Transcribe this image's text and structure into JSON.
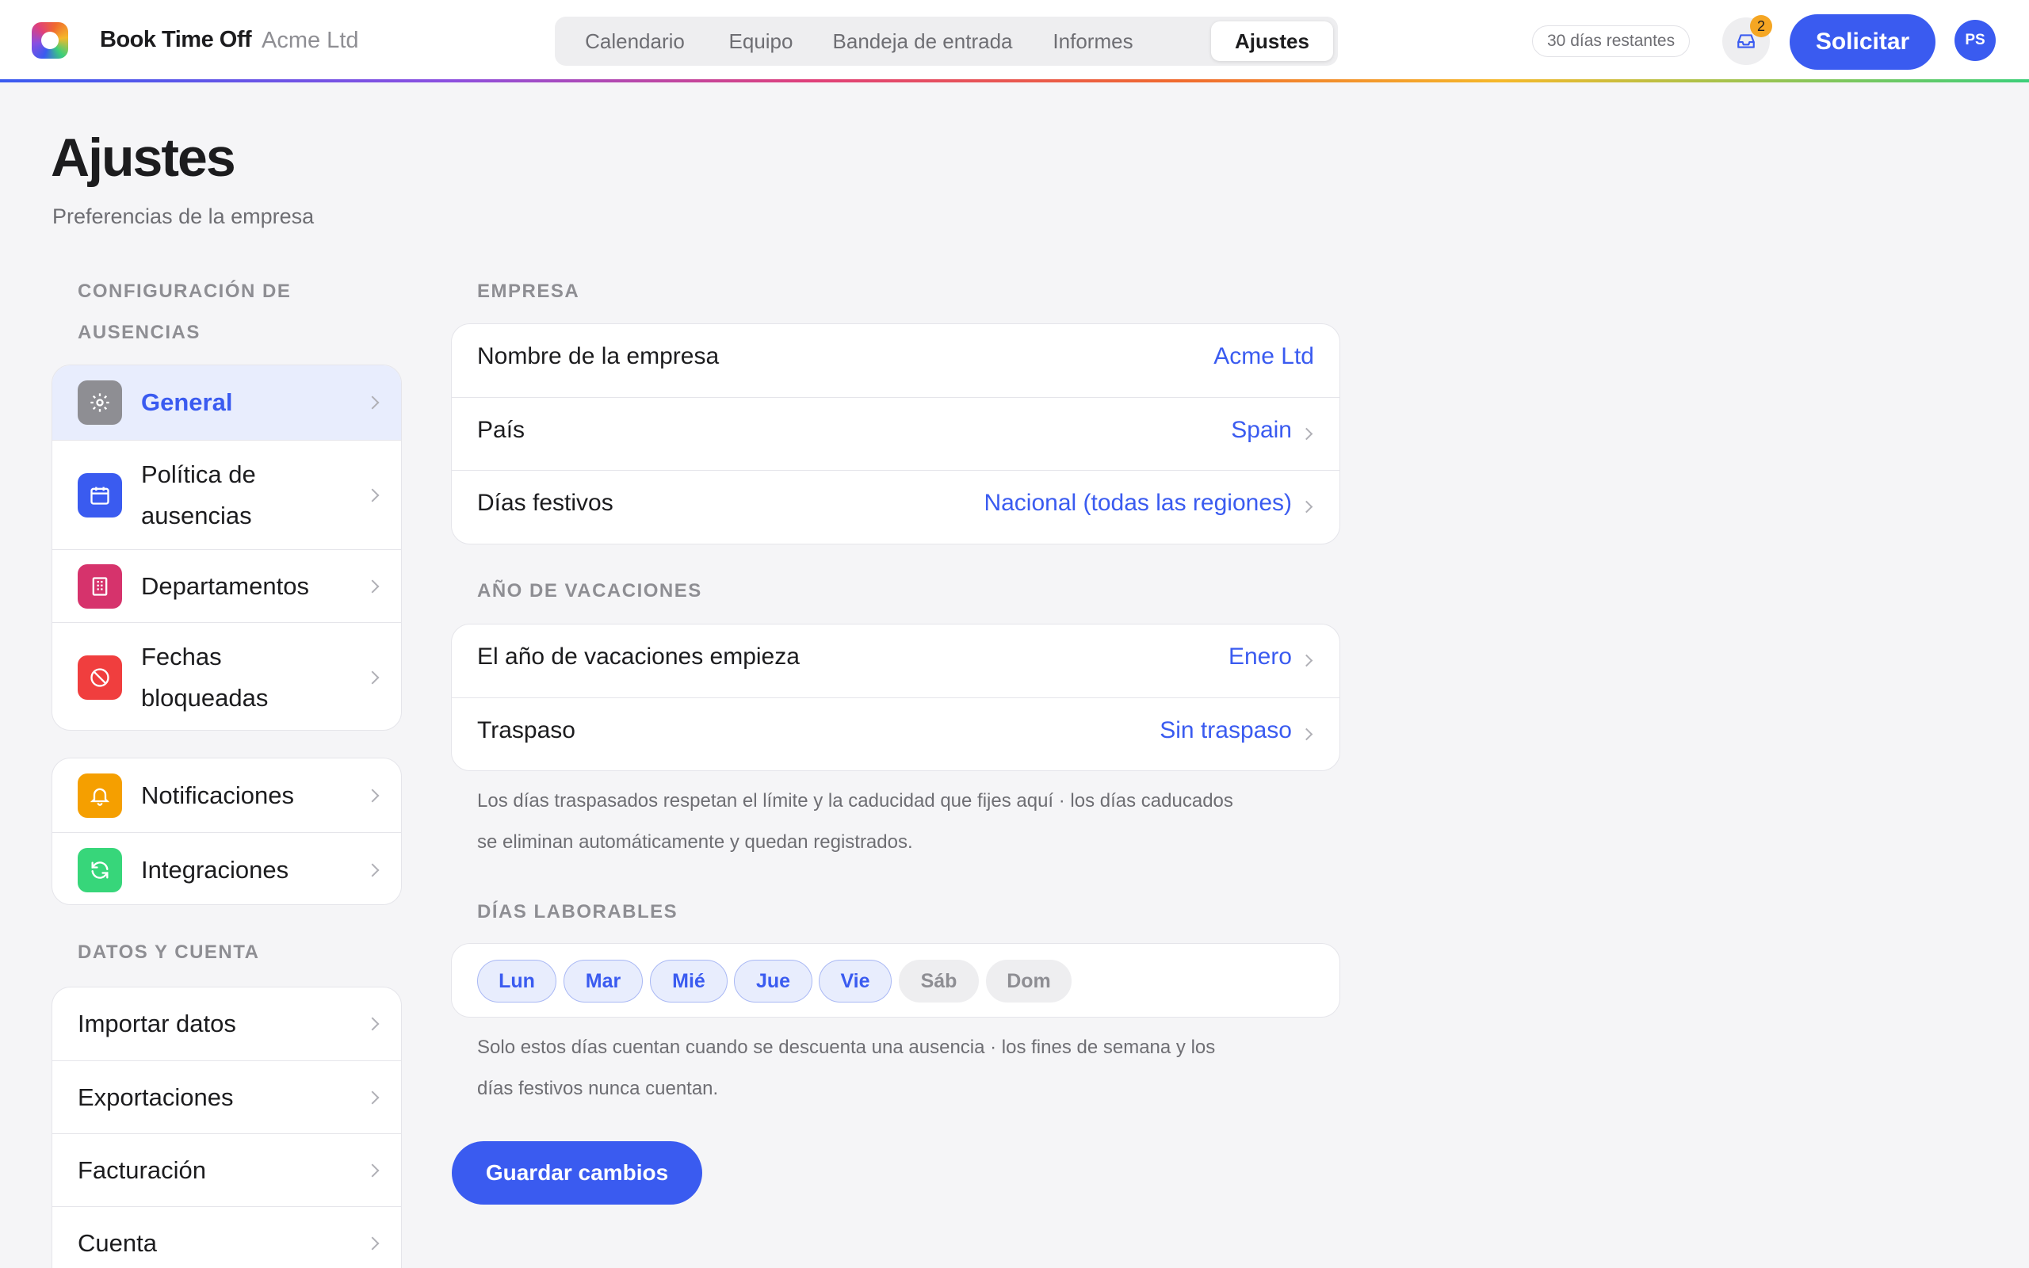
{
  "app": {
    "name": "Book Time Off",
    "company": "Acme Ltd"
  },
  "nav": {
    "tabs": [
      {
        "label": "Calendario"
      },
      {
        "label": "Equipo"
      },
      {
        "label": "Bandeja de entrada"
      },
      {
        "label": "Informes"
      },
      {
        "label": "Ajustes",
        "active": true
      }
    ]
  },
  "header": {
    "days_left": "30 días restantes",
    "inbox_count": "2",
    "request_label": "Solicitar",
    "avatar_initials": "PS"
  },
  "page": {
    "title": "Ajustes",
    "subtitle": "Preferencias de la empresa"
  },
  "sidebar": {
    "leave_section": "CONFIGURACIÓN DE AUSENCIAS",
    "leave_items": [
      {
        "label": "General",
        "icon": "gear-icon",
        "active": true
      },
      {
        "label": "Política de ausencias",
        "icon": "calendar-icon"
      },
      {
        "label": "Departamentos",
        "icon": "building-icon"
      },
      {
        "label": "Fechas bloqueadas",
        "icon": "block-icon"
      }
    ],
    "other_items": [
      {
        "label": "Notificaciones",
        "icon": "bell-icon"
      },
      {
        "label": "Integraciones",
        "icon": "sync-icon"
      }
    ],
    "data_section": "DATOS Y CUENTA",
    "data_items": [
      {
        "label": "Importar datos"
      },
      {
        "label": "Exportaciones"
      },
      {
        "label": "Facturación"
      },
      {
        "label": "Cuenta"
      }
    ]
  },
  "company": {
    "section": "EMPRESA",
    "rows": [
      {
        "label": "Nombre de la empresa",
        "value": "Acme Ltd"
      },
      {
        "label": "País",
        "value": "Spain"
      },
      {
        "label": "Días festivos",
        "value": "Nacional (todas las regiones)"
      }
    ]
  },
  "holiday_year": {
    "section": "AÑO DE VACACIONES",
    "rows": [
      {
        "label": "El año de vacaciones empieza",
        "value": "Enero"
      },
      {
        "label": "Traspaso",
        "value": "Sin traspaso"
      }
    ],
    "note": "Los días traspasados respetan el límite y la caducidad que fijes aquí · los días caducados se eliminan automáticamente y quedan registrados."
  },
  "working_days": {
    "section": "DÍAS LABORABLES",
    "days": [
      {
        "label": "Lun",
        "on": true
      },
      {
        "label": "Mar",
        "on": true
      },
      {
        "label": "Mié",
        "on": true
      },
      {
        "label": "Jue",
        "on": true
      },
      {
        "label": "Vie",
        "on": true
      },
      {
        "label": "Sáb",
        "on": false
      },
      {
        "label": "Dom",
        "on": false
      }
    ],
    "note": "Solo estos días cuentan cuando se descuenta una ausencia · los fines de semana y los días festivos nunca cuentan."
  },
  "save_label": "Guardar cambios",
  "colors": {
    "accent": "#3a5bf0",
    "gear_icon_bg": "#8e8e93",
    "calendar_icon_bg": "#3a5bf0",
    "building_icon_bg": "#d6336c",
    "block_icon_bg": "#f03e3e",
    "bell_icon_bg": "#f59f00",
    "sync_icon_bg": "#37d67a",
    "badge": "#f5a623"
  }
}
